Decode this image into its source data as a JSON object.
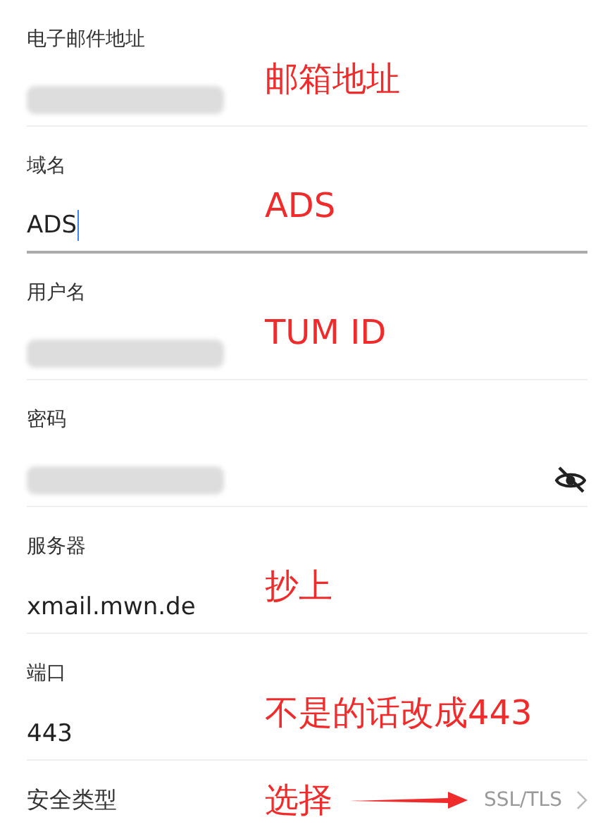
{
  "fields": [
    {
      "kind": "text",
      "label": "电子邮件地址",
      "redacted": true,
      "focused": false,
      "annotation": "邮箱地址"
    },
    {
      "kind": "text",
      "label": "域名",
      "value": "ADS",
      "focused": true,
      "annotation": "ADS"
    },
    {
      "kind": "text",
      "label": "用户名",
      "redacted": true,
      "focused": false,
      "annotation": "TUM ID"
    },
    {
      "kind": "password",
      "label": "密码",
      "redacted": true,
      "focused": false,
      "password_visible": false
    },
    {
      "kind": "text",
      "label": "服务器",
      "value": "xmail.mwn.de",
      "focused": false,
      "annotation": "抄上"
    },
    {
      "kind": "text",
      "label": "端口",
      "value": "443",
      "focused": false,
      "annotation": "不是的话改成443"
    },
    {
      "kind": "select",
      "label": "安全类型",
      "value": "SSL/TLS",
      "annotation": "选择"
    }
  ]
}
